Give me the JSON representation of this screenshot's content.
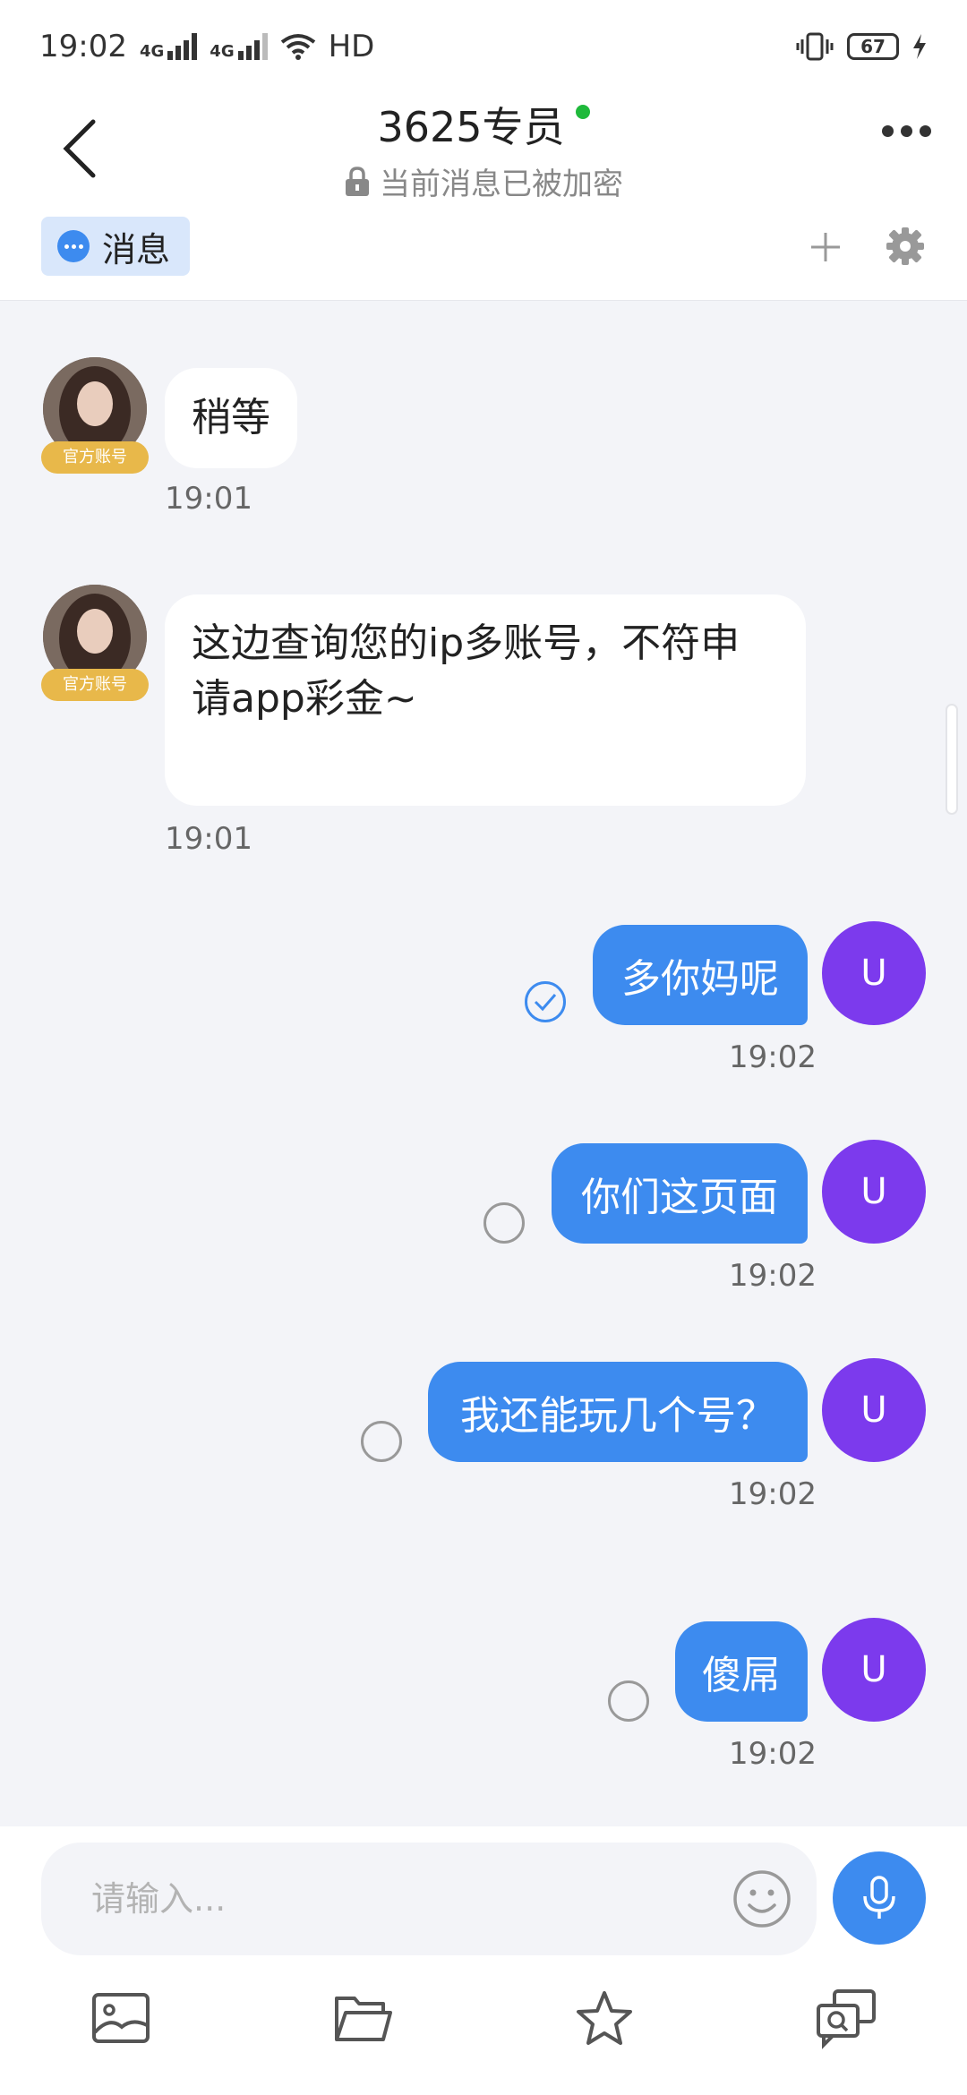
{
  "status_bar": {
    "time": "19:02",
    "network_1": "4G",
    "network_2": "4G",
    "hd": "HD",
    "battery": "67"
  },
  "header": {
    "title": "3625专员",
    "subtitle": "当前消息已被加密"
  },
  "tabs": {
    "messages_label": "消息"
  },
  "messages": [
    {
      "sender": "agent",
      "badge": "官方账号",
      "text": "稍等",
      "time": "19:01"
    },
    {
      "sender": "agent",
      "badge": "官方账号",
      "text_line1": "这边查询您的ip多账号，不符申",
      "text_line2": "请app彩金~",
      "time": "19:01"
    },
    {
      "sender": "user",
      "avatar_letter": "U",
      "text": "多你妈呢",
      "time": "19:02",
      "status": "read"
    },
    {
      "sender": "user",
      "avatar_letter": "U",
      "text": "你们这页面",
      "time": "19:02",
      "status": "sent"
    },
    {
      "sender": "user",
      "avatar_letter": "U",
      "text": "我还能玩几个号？",
      "time": "19:02",
      "status": "sent"
    },
    {
      "sender": "user",
      "avatar_letter": "U",
      "text": "傻屌",
      "time": "19:02",
      "status": "sent"
    }
  ],
  "input": {
    "placeholder": "请输入...",
    "value": ""
  },
  "colors": {
    "accent": "#3d8bef",
    "user_avatar": "#7c3aed",
    "badge": "#e8b84a",
    "online": "#1fb93b"
  },
  "icons": [
    "back-arrow-icon",
    "lock-icon",
    "more-icon",
    "plus-icon",
    "gear-icon",
    "emoji-icon",
    "microphone-icon",
    "image-icon",
    "folder-icon",
    "star-icon",
    "search-chat-icon"
  ]
}
